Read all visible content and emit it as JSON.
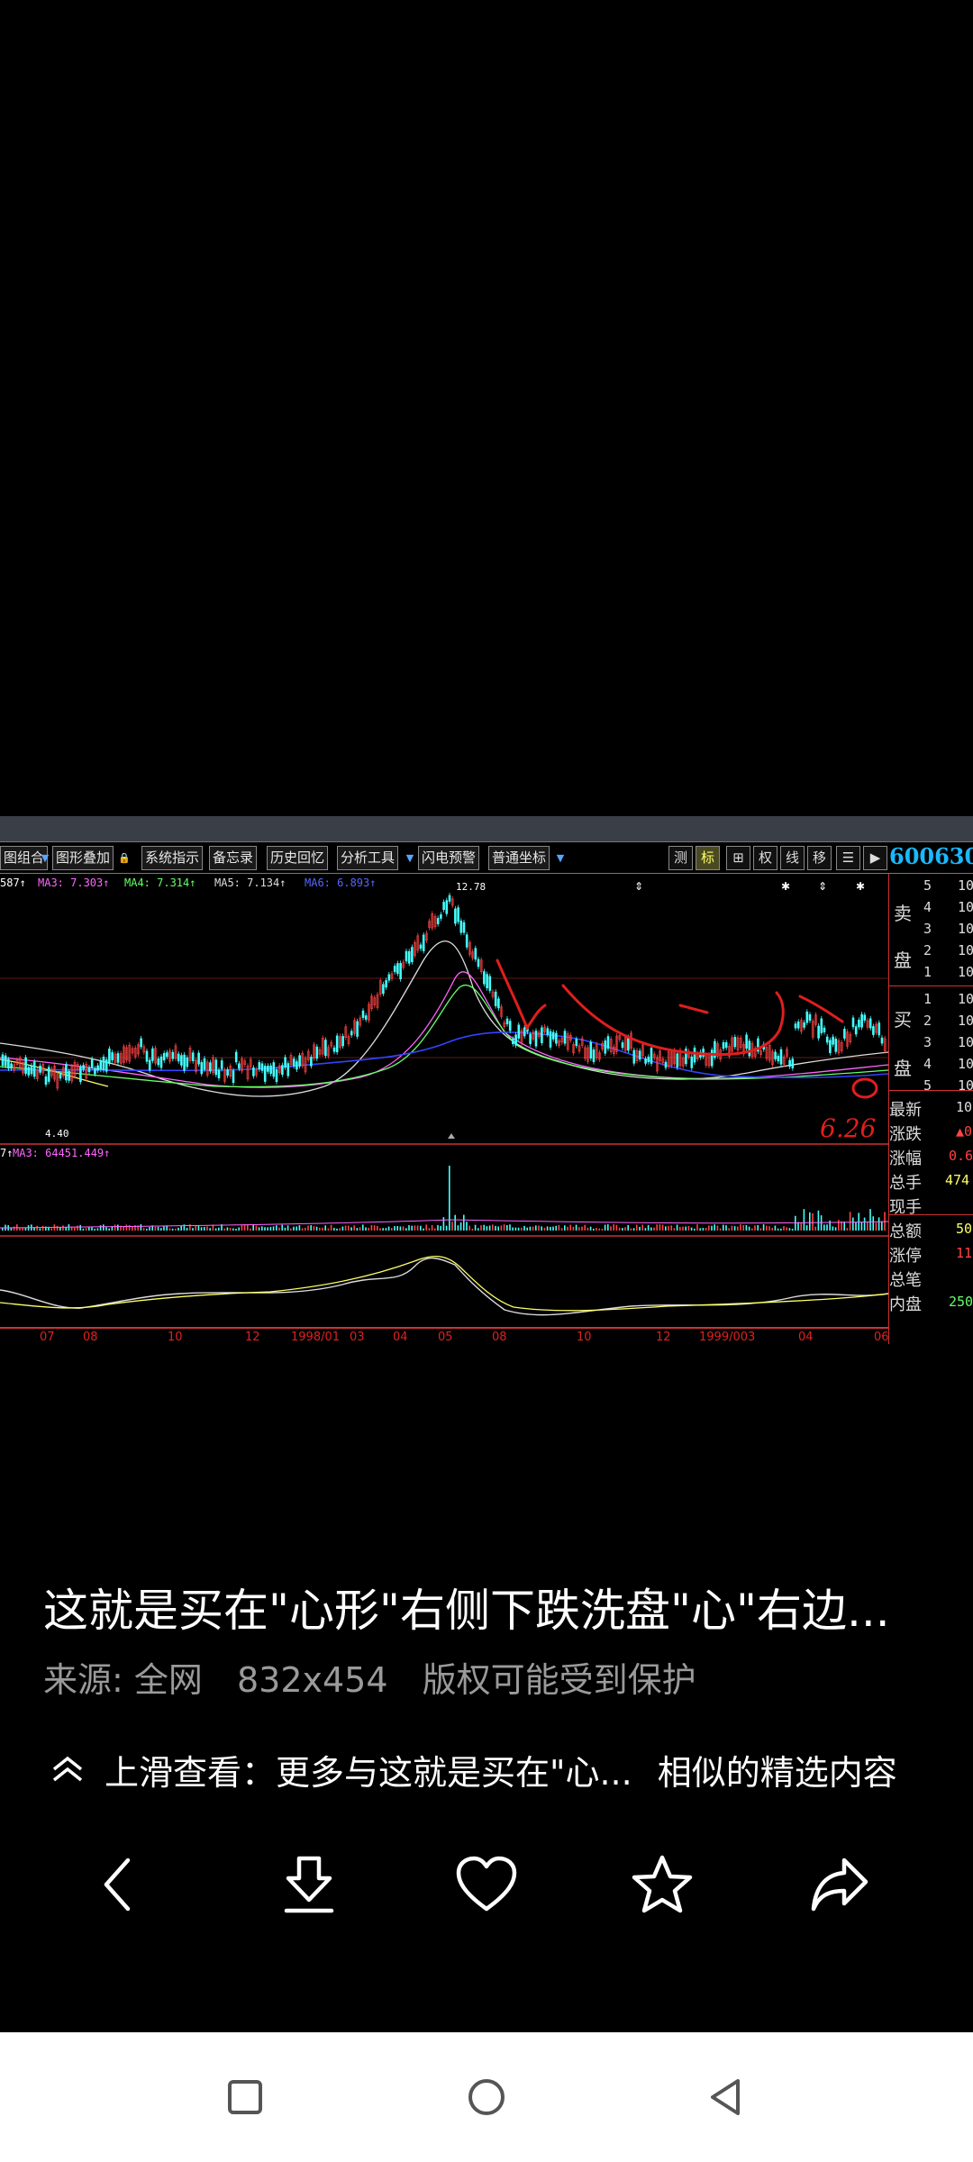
{
  "chart": {
    "toolbar": {
      "items": [
        "图组合",
        "图形叠加",
        "系统指示",
        "备忘录",
        "历史回忆",
        "分析工具",
        "闪电预警",
        "普通坐标"
      ],
      "right_buttons": [
        "测",
        "标",
        "⊞",
        "权",
        "线",
        "移",
        "☰",
        "▶"
      ]
    },
    "stock_code": "600630",
    "ma_values": {
      "lead": "587↑",
      "ma3": "MA3: 7.303↑",
      "ma4": "MA4: 7.314↑",
      "ma5": "MA5: 7.134↑",
      "ma6": "MA6: 6.893↑"
    },
    "high_label": "12.78",
    "low_label": "4.40",
    "volume_label": {
      "lead": "7↑",
      "ma3": "MA3: 64451.449↑"
    },
    "handwritten_note": "6.26",
    "x_ticks": [
      "07",
      "08",
      "10",
      "12",
      "1998/01",
      "03",
      "04",
      "05",
      "08",
      "10",
      "12",
      "1999/003",
      "04",
      "06"
    ],
    "side_panel": {
      "sell_label": [
        "卖",
        "盘"
      ],
      "buy_label": [
        "买",
        "盘"
      ],
      "sell_levels": [
        "5",
        "4",
        "3",
        "2",
        "1"
      ],
      "buy_levels": [
        "1",
        "2",
        "3",
        "4",
        "5"
      ],
      "level_values": [
        "10",
        "10",
        "10",
        "10",
        "10"
      ],
      "info_rows": [
        {
          "label": "最新",
          "value": "10"
        },
        {
          "label": "涨跌",
          "value": "▲0"
        },
        {
          "label": "涨幅",
          "value": "0.6"
        },
        {
          "label": "总手",
          "value": "474"
        },
        {
          "label": "现手",
          "value": ""
        },
        {
          "label": "总额",
          "value": "50"
        },
        {
          "label": "涨停",
          "value": "11"
        },
        {
          "label": "总笔",
          "value": ""
        },
        {
          "label": "内盘",
          "value": "250"
        }
      ]
    }
  },
  "caption": {
    "title": "这就是买在\"心形\"右侧下跌洗盘\"心\"右边...",
    "source": "来源: 全网",
    "dimensions": "832x454",
    "copyright": "版权可能受到保护",
    "swipe_text": "上滑查看：更多与这就是买在\"心...",
    "swipe_suffix": "相似的精选内容"
  },
  "actions": [
    "back-icon",
    "download-icon",
    "heart-icon",
    "star-icon",
    "share-icon"
  ],
  "nav": [
    "recent-apps-icon",
    "home-icon",
    "back-nav-icon"
  ]
}
